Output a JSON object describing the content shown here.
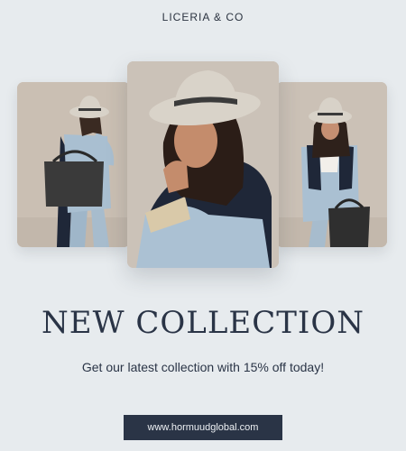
{
  "brand": "LICERIA & CO",
  "headline": "NEW COLLECTION",
  "subline": "Get our latest collection with 15% off today!",
  "cta": "www.hormuudglobal.com",
  "colors": {
    "background": "#e7ebee",
    "text": "#2a3446",
    "button": "#2a3446",
    "photo_backdrop": "#c9bfb4",
    "jacket_blue": "#a9bfd1",
    "navy": "#1f2738",
    "hat": "#d8d2c8"
  },
  "photos": [
    {
      "name": "photo-model-left"
    },
    {
      "name": "photo-model-center"
    },
    {
      "name": "photo-model-right"
    }
  ]
}
